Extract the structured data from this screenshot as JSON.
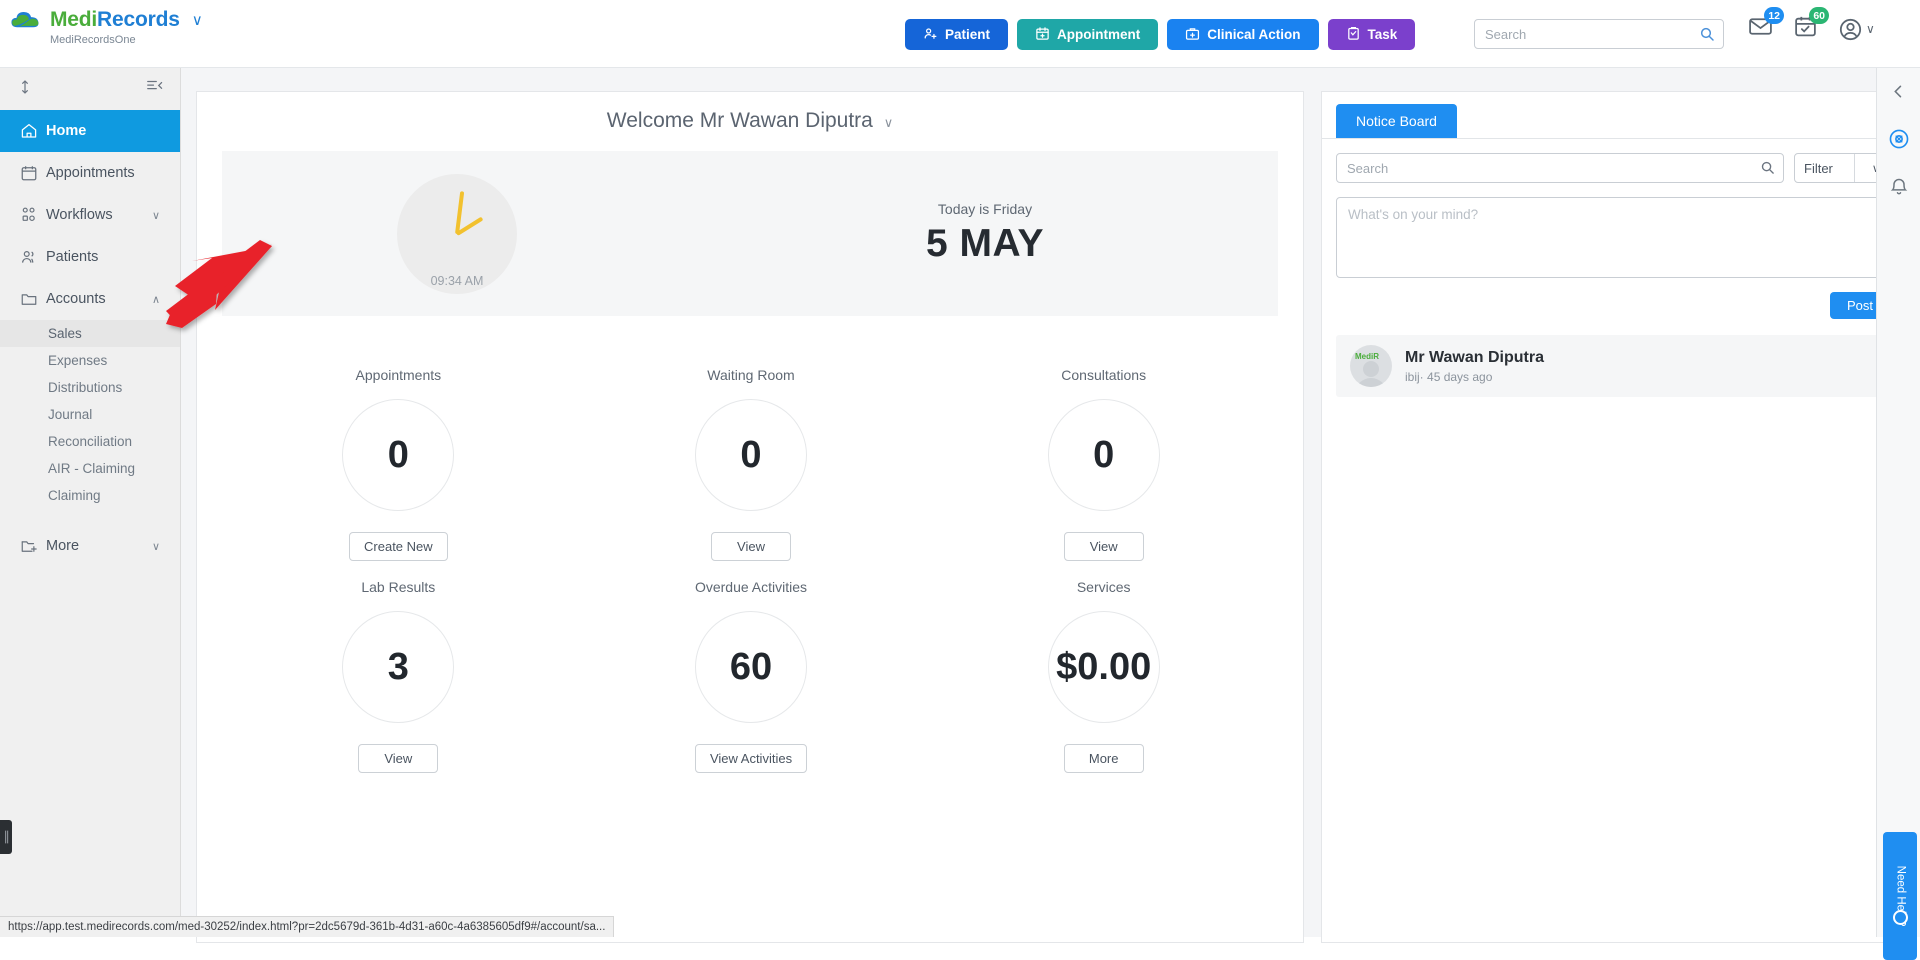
{
  "brand": {
    "name_part1": "Medi",
    "name_part2": "Records",
    "caret": "∨",
    "subtitle": "MediRecordsOne",
    "logo_icon": "cloud-logo-icon",
    "green": "#4aad3b",
    "blue": "#1f7fd4"
  },
  "topnav": {
    "buttons": [
      {
        "label": "Patient",
        "icon": "user-plus-icon",
        "color": "#1565d8"
      },
      {
        "label": "Appointment",
        "icon": "calendar-plus-icon",
        "color": "#1fa7a7"
      },
      {
        "label": "Clinical Action",
        "icon": "briefcase-medical-icon",
        "color": "#1a82f0"
      },
      {
        "label": "Task",
        "icon": "clipboard-check-icon",
        "color": "#7b40cc"
      }
    ],
    "search_placeholder": "Search",
    "search_value": "",
    "search_icon": "search-icon",
    "mail_icon": "envelope-icon",
    "mail_badge": "12",
    "tasks_icon": "calendar-check-icon",
    "tasks_badge": "60",
    "account_icon": "user-circle-icon",
    "account_caret": "∨"
  },
  "sidebar": {
    "resize_icon": "resize-vertical-icon",
    "collapse_icon": "collapse-panel-icon",
    "drag_handle_icon": "drag-handle-icon",
    "items": [
      {
        "label": "Home",
        "icon": "home-icon",
        "active": true,
        "expandable": false
      },
      {
        "label": "Appointments",
        "icon": "calendar-icon",
        "active": false,
        "expandable": false
      },
      {
        "label": "Workflows",
        "icon": "workflows-icon",
        "active": false,
        "expandable": true,
        "chevron": "∨"
      },
      {
        "label": "Patients",
        "icon": "patients-icon",
        "active": false,
        "expandable": false
      },
      {
        "label": "Accounts",
        "icon": "folder-icon",
        "active": false,
        "expandable": true,
        "chevron": "∧"
      }
    ],
    "accounts_children": [
      {
        "label": "Sales",
        "selected": true
      },
      {
        "label": "Expenses",
        "selected": false
      },
      {
        "label": "Distributions",
        "selected": false
      },
      {
        "label": "Journal",
        "selected": false
      },
      {
        "label": "Reconciliation",
        "selected": false
      },
      {
        "label": "AIR - Claiming",
        "selected": false
      },
      {
        "label": "Claiming",
        "selected": false
      }
    ],
    "more": {
      "label": "More",
      "icon": "folder-plus-icon",
      "chevron": "∨"
    }
  },
  "dashboard": {
    "welcome": "Welcome Mr Wawan Diputra",
    "welcome_caret": "∨",
    "clock_time": "09:34 AM",
    "today_label": "Today is Friday",
    "date_big": "5 MAY",
    "tiles_row1": [
      {
        "label": "Appointments",
        "value": "0",
        "button": "Create New"
      },
      {
        "label": "Waiting Room",
        "value": "0",
        "button": "View"
      },
      {
        "label": "Consultations",
        "value": "0",
        "button": "View"
      }
    ],
    "tiles_row2": [
      {
        "label": "Lab Results",
        "value": "3",
        "button": "View"
      },
      {
        "label": "Overdue Activities",
        "value": "60",
        "button": "View Activities"
      },
      {
        "label": "Services",
        "value": "$0.00",
        "button": "More"
      }
    ]
  },
  "notice_board": {
    "tab_label": "Notice Board",
    "search_placeholder": "Search",
    "search_value": "",
    "search_icon": "search-icon",
    "filter_label": "Filter",
    "filter_caret": "∨",
    "composer_placeholder": "What's on your mind?",
    "composer_value": "",
    "post_label": "Post",
    "posts": [
      {
        "author": "Mr Wawan Diputra",
        "handle": "ibij",
        "separator": "·",
        "time": "45 days ago",
        "avatar_icon": "user-avatar-icon",
        "avatar_brand": "MediR"
      }
    ]
  },
  "right_rail": {
    "collapse_icon": "chevron-left-icon",
    "support_icon": "headset-support-icon",
    "bell_icon": "bell-icon",
    "help_label": "Need Help?",
    "help_dot_icon": "chat-dot-icon"
  },
  "status_bar": {
    "url": "https://app.test.medirecords.com/med-30252/index.html?pr=2dc5679d-361b-4d31-a60c-4a6385605df9#/account/sa..."
  },
  "annotation": {
    "arrow_icon": "red-arrow-pointer",
    "arrow_color": "#e8232a"
  }
}
